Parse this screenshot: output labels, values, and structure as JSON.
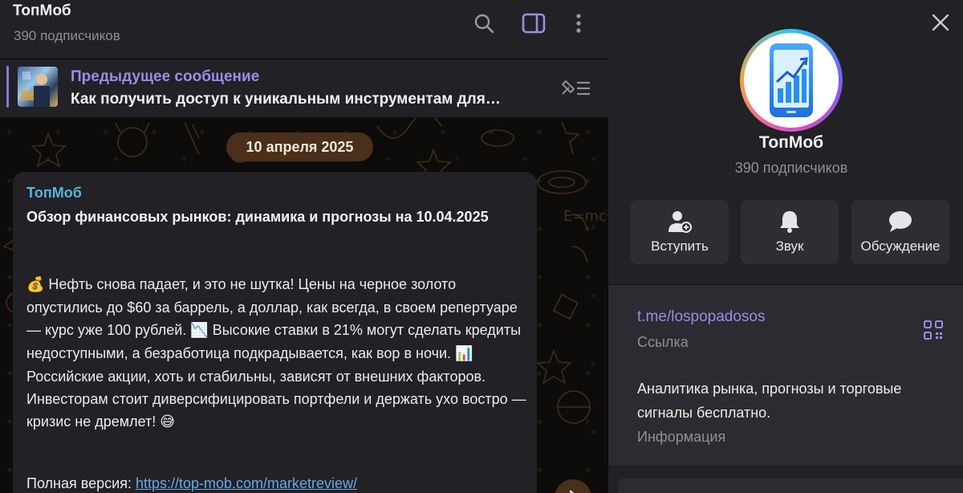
{
  "header": {
    "title": "ТопМоб",
    "subscribers": "390 подписчиков",
    "icons": [
      "search-icon",
      "sidebar-toggle-icon",
      "more-vertical-icon"
    ]
  },
  "pinned": {
    "label": "Предыдущее сообщение",
    "text": "Как получить доступ к уникальным инструментам для…",
    "icon": "pin-list-icon"
  },
  "chat": {
    "date": "10 апреля 2025",
    "message": {
      "author": "ТопМоб",
      "headline": "Обзор финансовых рынков: динамика и прогнозы на 10.04.2025",
      "emoji_moneybag": "💰",
      "text_1": " Нефть снова падает, и это не шутка! Цены на черное золото опустились до $60 за баррель, а доллар, как всегда, в своем репертуаре — курс уже 100 рублей. ",
      "emoji_chart_down": "📉",
      "text_2": " Высокие ставки в 21% могут сделать кредиты недоступными, а безработица подкрадывается, как вор в ночи. ",
      "emoji_bar_chart": "📊",
      "text_3": " Российские акции, хоть и стабильны, зависят от внешних факторов. Инвесторам стоит диверсифицировать портфели и держать ухо востро — кризис не дремлет! ",
      "emoji_smile": "😅",
      "full_label": "Полная версия: ",
      "full_link": "https://top-mob.com/marketreview/"
    }
  },
  "panel": {
    "name": "ТопМоб",
    "subscribers": "390 подписчиков",
    "actions": [
      {
        "label": "Вступить",
        "icon": "join-user-icon"
      },
      {
        "label": "Звук",
        "icon": "bell-icon"
      },
      {
        "label": "Обсуждение",
        "icon": "chat-bubble-icon"
      }
    ],
    "link": {
      "value": "t.me/lospopadosos",
      "label": "Ссылка"
    },
    "info": {
      "value": "Аналитика рынка, прогнозы и торговые сигналы бесплатно.",
      "label": "Информация"
    }
  },
  "colors": {
    "accent": "#a08ae6",
    "author": "#5bb4dc",
    "date_pill": "#4a2f1a"
  }
}
